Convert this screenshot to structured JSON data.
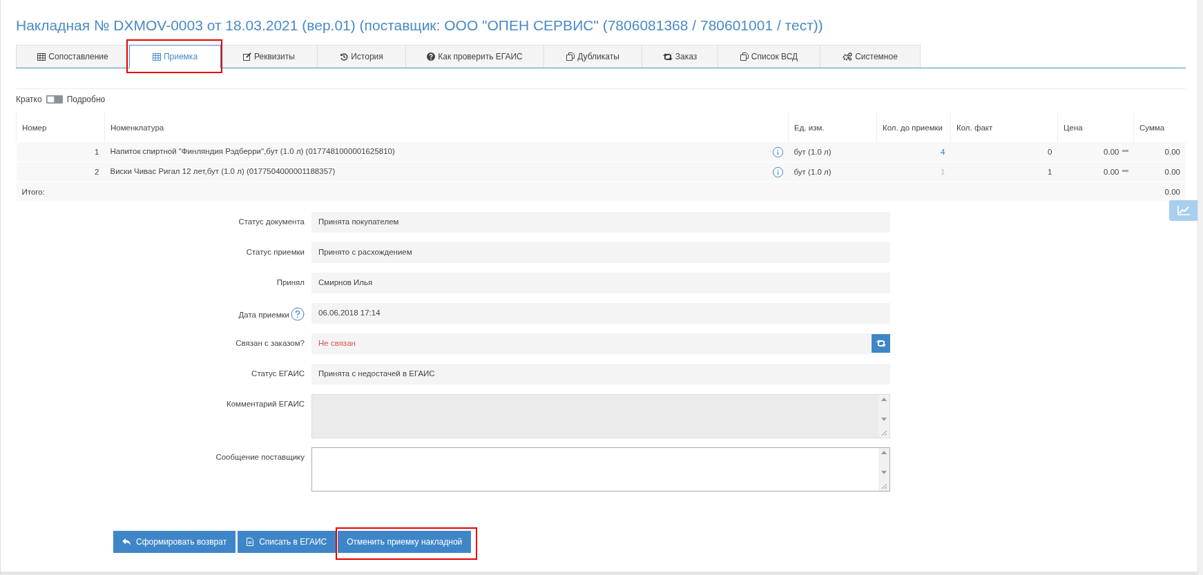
{
  "title": "Накладная № DXMOV-0003 от 18.03.2021 (вер.01) (поставщик: ООО \"ОПЕН СЕРВИС\" (7806081368 / 780601001 / тест))",
  "tabs": [
    {
      "label": "Сопоставление",
      "selected": false
    },
    {
      "label": "Приемка",
      "selected": true,
      "highlighted": true
    },
    {
      "label": "Реквизиты",
      "selected": false
    },
    {
      "label": "История",
      "selected": false
    },
    {
      "label": "Как проверить ЕГАИС",
      "selected": false
    },
    {
      "label": "Дубликаты",
      "selected": false
    },
    {
      "label": "Заказ",
      "selected": false
    },
    {
      "label": "Список ВСД",
      "selected": false
    },
    {
      "label": "Системное",
      "selected": false
    }
  ],
  "view_toggle": {
    "left_label": "Кратко",
    "right_label": "Подробно",
    "on": false
  },
  "table": {
    "columns": [
      "Номер",
      "Номенклатура",
      "Ед. изм.",
      "Кол. до приемки",
      "Кол. факт",
      "Цена",
      "Сумма"
    ],
    "rows": [
      {
        "number": "1",
        "name": "Напиток спиртной \"Финляндия Рэдберри\",бут (1.0 л) (0177481000001625810)",
        "unit": "бут (1.0 л)",
        "qty_before": "4",
        "qty_before_muted": false,
        "qty_fact": "0",
        "price": "0.00",
        "sum": "0.00"
      },
      {
        "number": "2",
        "name": "Виски Чивас Ригал 12 лет,бут (1.0 л) (0177504000001188357)",
        "unit": "бут (1.0 л)",
        "qty_before": "1",
        "qty_before_muted": true,
        "qty_fact": "1",
        "price": "0.00",
        "sum": "0.00"
      }
    ],
    "total_label": "Итого:",
    "total_sum": "0.00"
  },
  "form": [
    {
      "kind": "text",
      "label": "Статус документа",
      "value": "Принята покупателем"
    },
    {
      "kind": "text",
      "label": "Статус приемки",
      "value": "Принято с расхождением"
    },
    {
      "kind": "text",
      "label": "Принял",
      "value": "Смирнов Илья"
    },
    {
      "kind": "text",
      "label": "Дата приемки",
      "value": "06.06.2018 17:14",
      "help": true
    },
    {
      "kind": "linked",
      "label": "Связан с заказом?",
      "value": "Не связан",
      "alert": true
    },
    {
      "kind": "text",
      "label": "Статус ЕГАИС",
      "value": "Принята с недостачей в ЕГАИС"
    },
    {
      "kind": "textarea",
      "label": "Комментарий ЕГАИС",
      "disabled": true
    },
    {
      "kind": "textarea",
      "label": "Сообщение поставщику",
      "disabled": false
    }
  ],
  "actions": [
    {
      "label": "Сформировать возврат",
      "highlighted": false
    },
    {
      "label": "Списать в ЕГАИС",
      "highlighted": false
    },
    {
      "label": "Отменить приемку накладной",
      "highlighted": true
    }
  ]
}
